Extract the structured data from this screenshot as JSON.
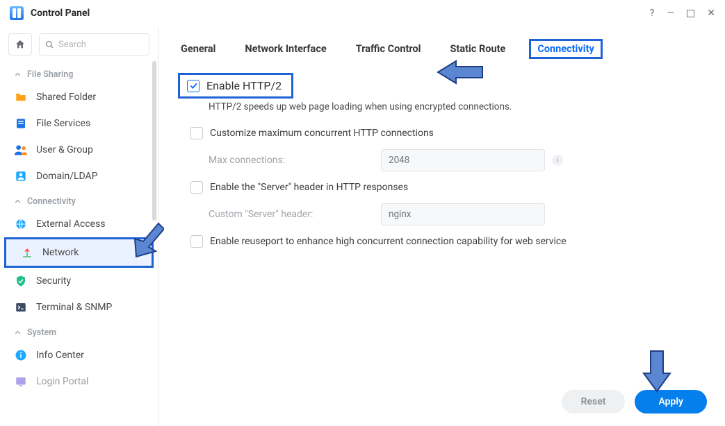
{
  "window": {
    "title": "Control Panel"
  },
  "search": {
    "placeholder": "Search"
  },
  "sidebar": {
    "sections": [
      {
        "label": "File Sharing",
        "items": [
          {
            "label": "Shared Folder"
          },
          {
            "label": "File Services"
          },
          {
            "label": "User & Group"
          },
          {
            "label": "Domain/LDAP"
          }
        ]
      },
      {
        "label": "Connectivity",
        "items": [
          {
            "label": "External Access"
          },
          {
            "label": "Network"
          },
          {
            "label": "Security"
          },
          {
            "label": "Terminal & SNMP"
          }
        ]
      },
      {
        "label": "System",
        "items": [
          {
            "label": "Info Center"
          },
          {
            "label": "Login Portal"
          }
        ]
      }
    ]
  },
  "tabs": [
    {
      "label": "General"
    },
    {
      "label": "Network Interface"
    },
    {
      "label": "Traffic Control"
    },
    {
      "label": "Static Route"
    },
    {
      "label": "Connectivity",
      "active": true
    }
  ],
  "form": {
    "http2": {
      "label": "Enable HTTP/2",
      "checked": true,
      "note": "HTTP/2 speeds up web page loading when using encrypted connections."
    },
    "maxconn": {
      "label": "Customize maximum concurrent HTTP connections",
      "field_label": "Max connections:",
      "placeholder": "2048"
    },
    "server_header": {
      "label": "Enable the \"Server\" header in HTTP responses",
      "field_label": "Custom \"Server\" header:",
      "placeholder": "nginx"
    },
    "reuseport": {
      "label": "Enable reuseport to enhance high concurrent connection capability for web service"
    }
  },
  "buttons": {
    "reset": "Reset",
    "apply": "Apply"
  }
}
